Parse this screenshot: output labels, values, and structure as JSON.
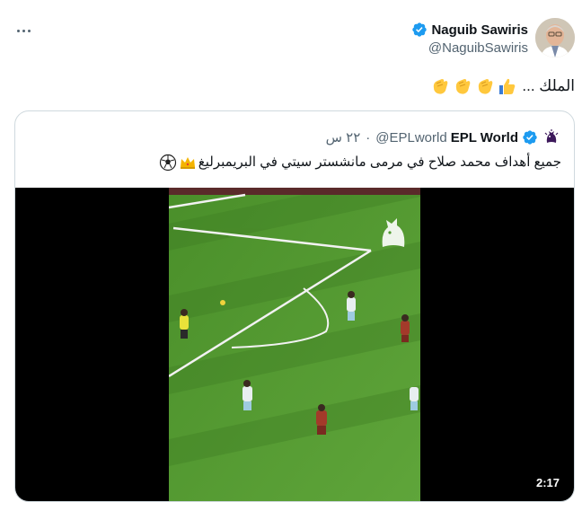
{
  "tweet": {
    "author_name": "Naguib Sawiris",
    "author_handle": "@NaguibSawiris",
    "text": "الملك ...",
    "emojis": [
      "thumbs-up",
      "clapping-hands",
      "clapping-hands",
      "clapping-hands"
    ]
  },
  "quote": {
    "author_name": "EPL World",
    "author_handle": "@EPLworld",
    "separator": "·",
    "time": "٢٢ س",
    "text": "جميع أهداف محمد صلاح في مرمى مانشستر سيتي في البريمبرليغ",
    "emojis": [
      "crown",
      "soccer-ball"
    ]
  },
  "video": {
    "duration": "2:17"
  },
  "colors": {
    "verified": "#1d9bf0",
    "secondary_text": "#536471",
    "border": "#cfd9de",
    "pitch_green": "#4e9a2e"
  }
}
